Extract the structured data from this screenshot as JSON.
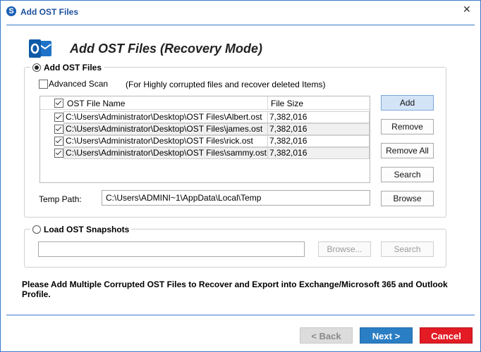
{
  "window": {
    "title": "Add OST Files",
    "app_icon_letter": "S"
  },
  "header": {
    "title": "Add OST Files (Recovery Mode)"
  },
  "add_group": {
    "legend": "Add OST Files",
    "advanced_scan_label": "Advanced Scan",
    "advanced_scan_hint": "(For Highly corrupted files and recover deleted Items)",
    "table": {
      "columns": [
        "OST File Name",
        "File Size"
      ],
      "rows": [
        {
          "name": "C:\\Users\\Administrator\\Desktop\\OST Files\\Albert.ost",
          "size": "7,382,016"
        },
        {
          "name": "C:\\Users\\Administrator\\Desktop\\OST Files\\james.ost",
          "size": "7,382,016"
        },
        {
          "name": "C:\\Users\\Administrator\\Desktop\\OST Files\\rick.ost",
          "size": "7,382,016"
        },
        {
          "name": "C:\\Users\\Administrator\\Desktop\\OST Files\\sammy.ost",
          "size": "7,382,016"
        }
      ]
    },
    "temp_path_label": "Temp Path:",
    "temp_path_value": "C:\\Users\\ADMINI~1\\AppData\\Local\\Temp",
    "buttons": {
      "add": "Add",
      "remove": "Remove",
      "remove_all": "Remove All",
      "search": "Search",
      "browse": "Browse"
    }
  },
  "snapshot_group": {
    "legend": "Load OST Snapshots",
    "browse": "Browse...",
    "search": "Search"
  },
  "note": "Please Add Multiple Corrupted OST Files to Recover and Export into Exchange/Microsoft 365 and Outlook Profile.",
  "nav": {
    "back": "< Back",
    "next": "Next >",
    "cancel": "Cancel"
  },
  "colors": {
    "accent": "#2a7ec4",
    "cancel": "#e21b24",
    "title_blue": "#1a4f9c"
  }
}
